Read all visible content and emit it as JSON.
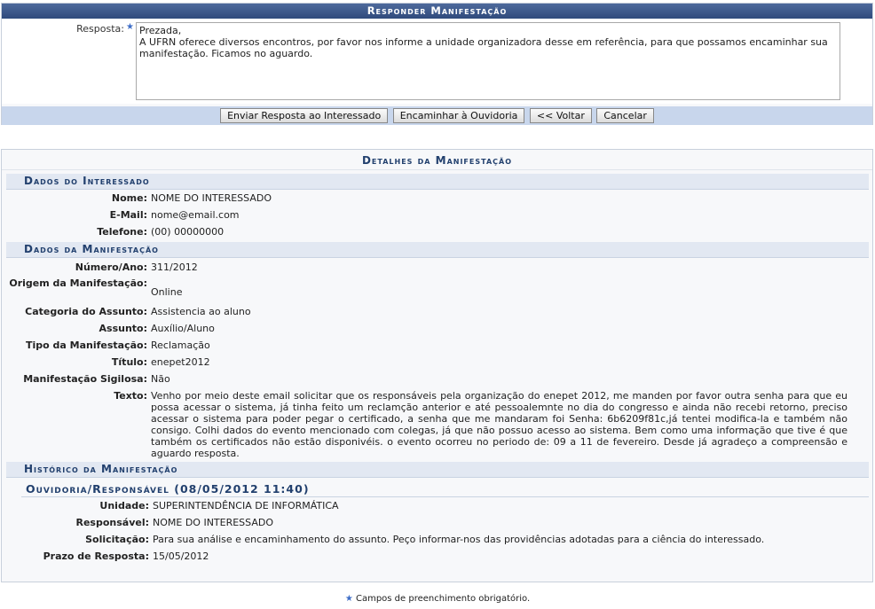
{
  "form": {
    "title": "Responder Manifestação",
    "resposta_label": "Resposta:",
    "resposta_value": "Prezada,\nA UFRN oferece diversos encontros, por favor nos informe a unidade organizadora desse em referência, para que possamos encaminhar sua manifestação. Ficamos no aguardo.",
    "buttons": {
      "enviar": "Enviar Resposta ao Interessado",
      "encaminhar": "Encaminhar à Ouvidoria",
      "voltar": "<< Voltar",
      "cancelar": "Cancelar"
    }
  },
  "details": {
    "caption": "Detalhes da Manifestação",
    "interessado": {
      "heading": "Dados do Interessado",
      "nome_label": "Nome:",
      "nome": "NOME DO INTERESSADO",
      "email_label": "E-Mail:",
      "email": "nome@email.com",
      "telefone_label": "Telefone:",
      "telefone": "(00) 00000000"
    },
    "manifestacao": {
      "heading": "Dados da Manifestação",
      "numero_label": "Número/Ano:",
      "numero": "311/2012",
      "origem_label": "Origem da Manifestação:",
      "origem": "Online",
      "categoria_label": "Categoria do Assunto:",
      "categoria": "Assistencia ao aluno",
      "assunto_label": "Assunto:",
      "assunto": "Auxílio/Aluno",
      "tipo_label": "Tipo da Manifestação:",
      "tipo": "Reclamação",
      "titulo_label": "Título:",
      "titulo": "enepet2012",
      "sigilosa_label": "Manifestação Sigilosa:",
      "sigilosa": "Não",
      "texto_label": "Texto:",
      "texto": "Venho por meio deste email solicitar que os responsáveis pela organização do enepet 2012, me manden por favor outra senha para que eu possa acessar o sistema, já tinha feito um reclamção anterior e até pessoalemnte no dia do congresso e ainda não recebi retorno, preciso acessar o sistema para poder pegar o certificado, a senha que me mandaram foi Senha: 6b6209f81c,já tentei modifica-la e também não consigo. Colhi dados do evento mencionado com colegas, já que não possuo acesso ao sistema. Bem como uma informação que tive é que também os certificados não estão disponivéis. o evento ocorreu no periodo de: 09 a 11 de fevereiro. Desde já agradeço a compreensão e aguardo resposta."
    },
    "historico": {
      "heading": "Histórico da Manifestação",
      "entry_title": "Ouvidoria/Responsável (08/05/2012 11:40)",
      "unidade_label": "Unidade:",
      "unidade": "SUPERINTENDÊNCIA DE INFORMÁTICA",
      "responsavel_label": "Responsável:",
      "responsavel": "NOME DO INTERESSADO",
      "solicitacao_label": "Solicitação:",
      "solicitacao": "Para sua análise e encaminhamento do assunto. Peço informar-nos das providências adotadas para a ciência do interessado.",
      "prazo_label": "Prazo de Resposta:",
      "prazo": "15/05/2012"
    }
  },
  "footer": {
    "required_note": "Campos de preenchimento obrigatório."
  },
  "icons": {
    "required": "asterisk-icon"
  }
}
